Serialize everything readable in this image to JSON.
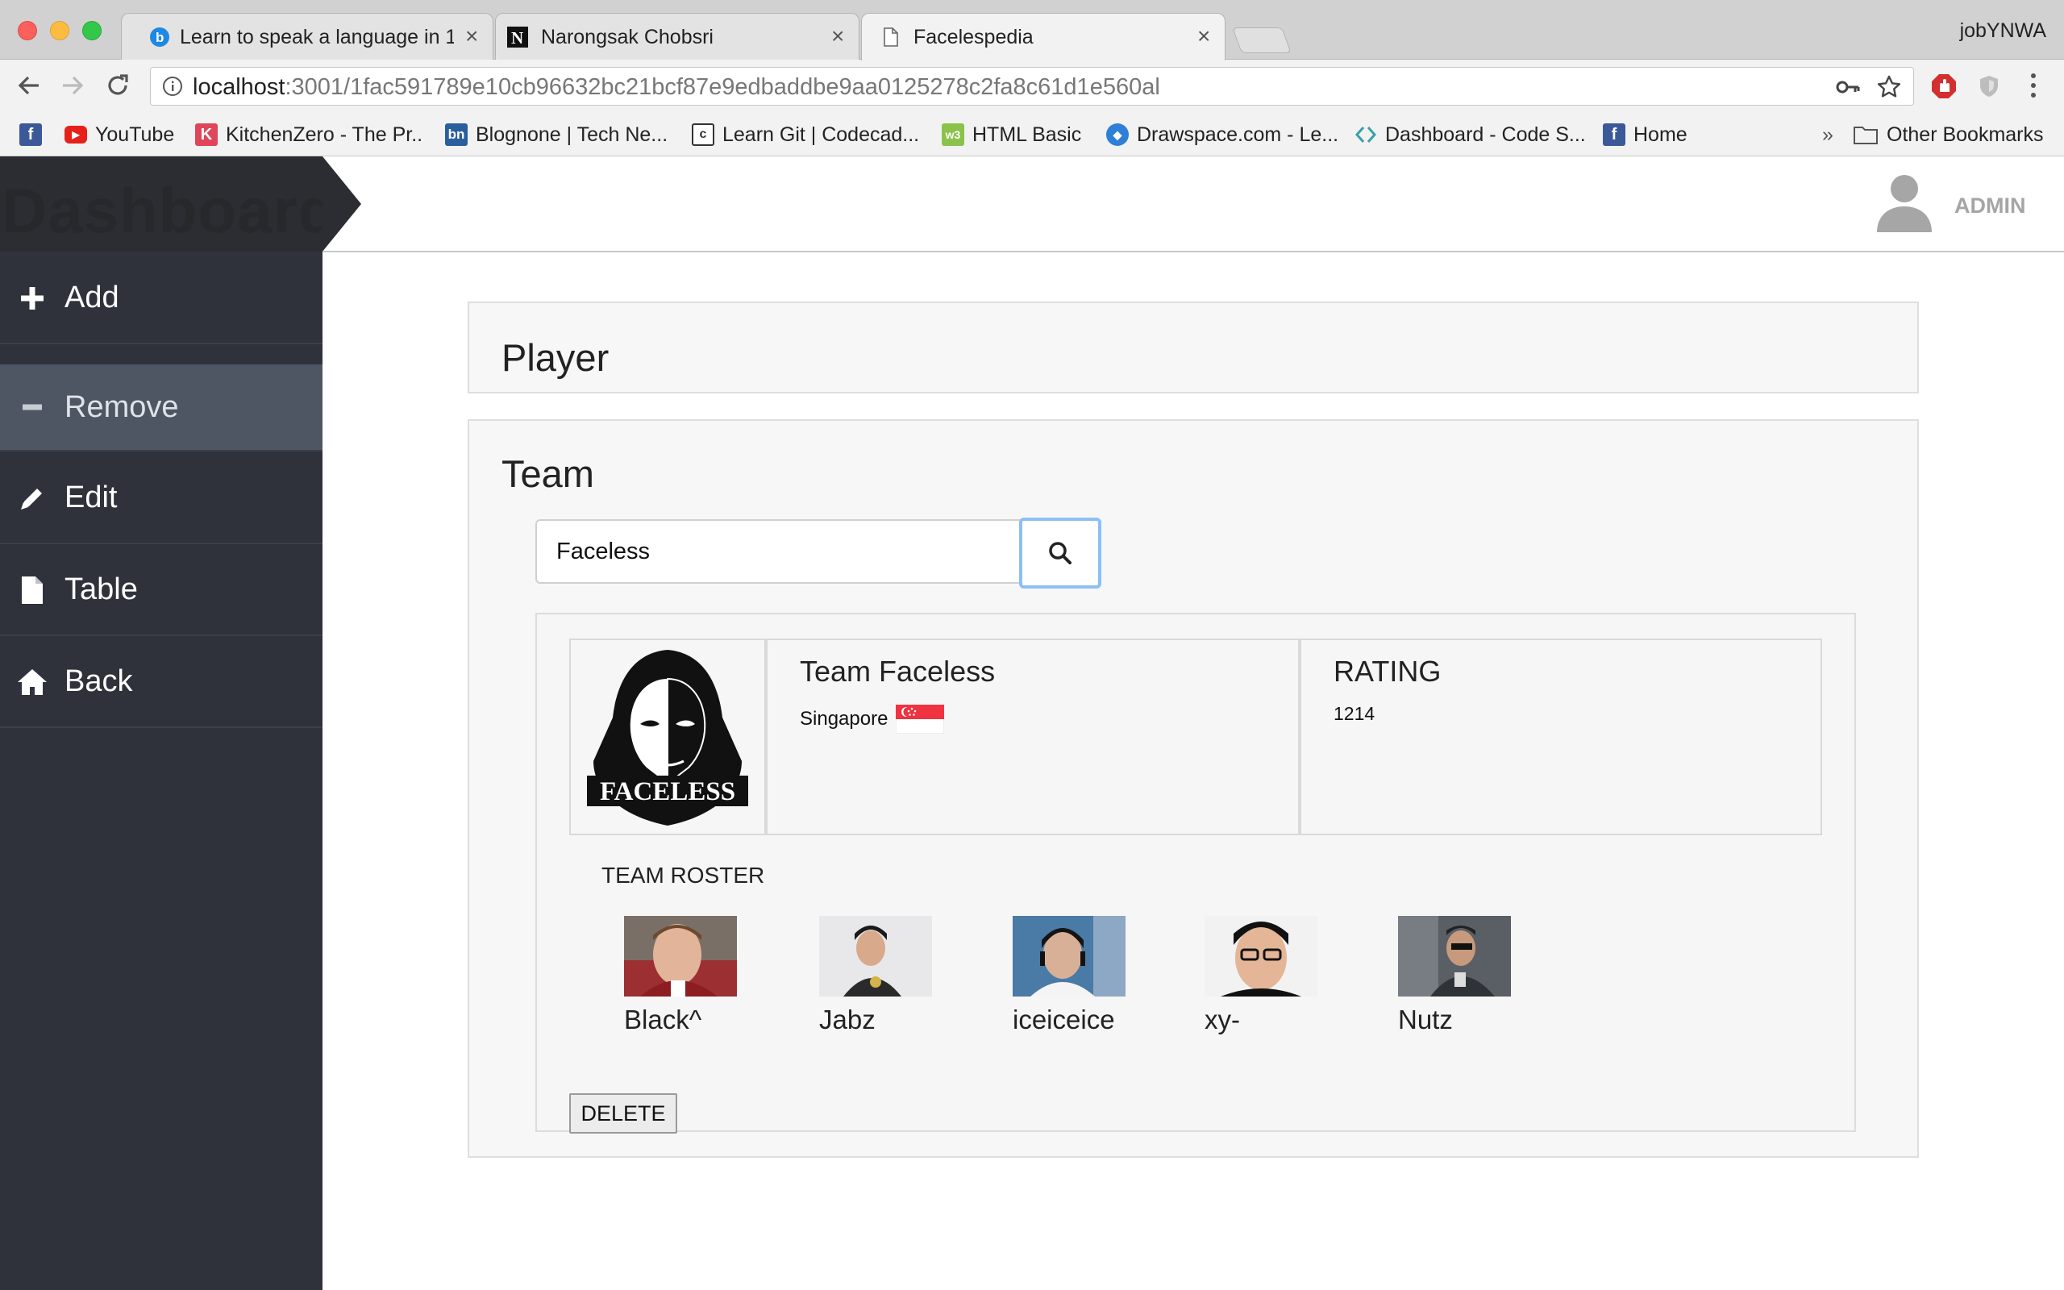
{
  "browser": {
    "tabs": [
      {
        "title": "Learn to speak a language in 10"
      },
      {
        "title": "Narongsak Chobsri"
      },
      {
        "title": "Facelespedia"
      }
    ],
    "profile": "jobYNWA",
    "url_host": "localhost",
    "url_rest": ":3001/1fac591789e10cb96632bc21bcf87e9edbaddbe9aa0125278c2fa8c61d1e560al",
    "bookmarks": [
      {
        "label": ""
      },
      {
        "label": "YouTube"
      },
      {
        "label": "KitchenZero - The Pr.."
      },
      {
        "label": "Blognone | Tech Ne..."
      },
      {
        "label": "Learn Git | Codecad..."
      },
      {
        "label": "HTML Basic"
      },
      {
        "label": "Drawspace.com - Le..."
      },
      {
        "label": "Dashboard - Code S..."
      },
      {
        "label": "Home"
      }
    ],
    "bookmarks_overflow": "»",
    "other_bookmarks": "Other Bookmarks"
  },
  "sidebar": {
    "brand": "Dashboard",
    "items": [
      {
        "label": "Add",
        "icon": "plus-icon"
      },
      {
        "label": "Remove",
        "icon": "minus-icon",
        "active": true
      },
      {
        "label": "Edit",
        "icon": "pencil-icon"
      },
      {
        "label": "Table",
        "icon": "file-icon"
      },
      {
        "label": "Back",
        "icon": "home-icon"
      }
    ]
  },
  "header": {
    "user": "ADMIN"
  },
  "player_section": {
    "title": "Player"
  },
  "team_section": {
    "title": "Team",
    "search_value": "Faceless",
    "result": {
      "name": "Team Faceless",
      "country": "Singapore",
      "rating_label": "RATING",
      "rating": "1214",
      "logo_text": "FACELESS",
      "roster_label": "TEAM ROSTER",
      "roster": [
        {
          "name": "Black^"
        },
        {
          "name": "Jabz"
        },
        {
          "name": "iceiceice"
        },
        {
          "name": "xy-"
        },
        {
          "name": "Nutz"
        }
      ],
      "delete_label": "DELETE"
    }
  },
  "colors": {
    "sidebar_bg": "#2f323a",
    "sidebar_active": "#4e5663",
    "focus_ring": "#8cc0f5",
    "panel_bg": "#f7f7f7"
  }
}
